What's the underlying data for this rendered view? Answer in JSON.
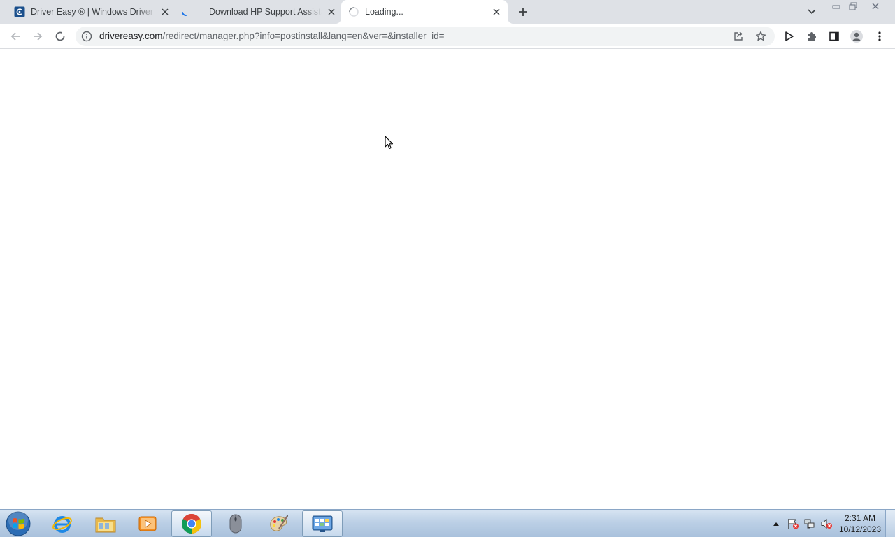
{
  "browser": {
    "tabs": [
      {
        "title": "Driver Easy ® | Windows Driver Updater",
        "favicon": "driver-easy-icon",
        "state": "inactive"
      },
      {
        "title": "Download HP Support Assistant | Driver Easy",
        "favicon": "loading-spinner-icon",
        "state": "inactive"
      },
      {
        "title": "Loading...",
        "favicon": "loading-spinner-icon",
        "state": "active"
      }
    ],
    "new_tab_icon": "plus-icon",
    "address": {
      "host": "drivereasy.com",
      "path": "/redirect/manager.php?info=postinstall&lang=en&ver=&installer_id="
    },
    "status": "loading"
  },
  "taskbar": {
    "apps": [
      {
        "name": "internet-explorer-icon"
      },
      {
        "name": "file-explorer-icon"
      },
      {
        "name": "media-player-icon"
      },
      {
        "name": "chrome-icon"
      },
      {
        "name": "mouse-icon"
      },
      {
        "name": "paint-icon"
      },
      {
        "name": "control-panel-icon"
      }
    ],
    "clock": {
      "time": "2:31 AM",
      "date": "10/12/2023"
    }
  },
  "colors": {
    "tabstrip": "#dee1e6",
    "omnibox": "#f1f3f4",
    "taskbar": "#bcd0e6",
    "driver_easy_blue": "#1a4f8c"
  }
}
